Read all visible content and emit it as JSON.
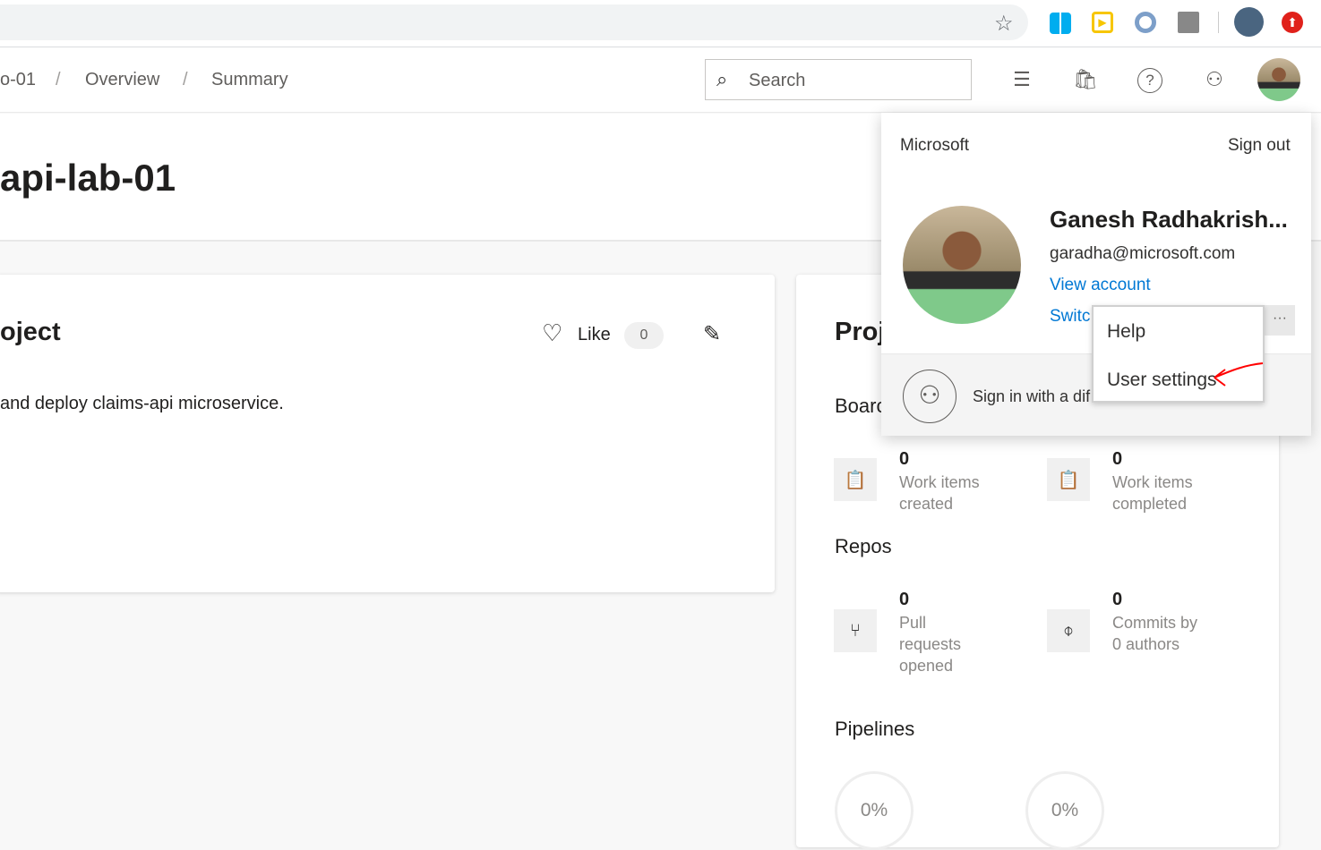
{
  "browser": {
    "icons": [
      "star-icon",
      "windows-icon",
      "play-icon",
      "cortana-icon",
      "office-icon",
      "profile-avatar",
      "update-icon"
    ]
  },
  "breadcrumb": [
    "o-01",
    "/",
    "Overview",
    "/",
    "Summary"
  ],
  "search": {
    "placeholder": "Search"
  },
  "header_icons": [
    "task-list-icon",
    "shopping-bag-icon",
    "help-icon",
    "user-settings-icon",
    "avatar"
  ],
  "page_title": "api-lab-01",
  "about": {
    "title": "oject",
    "like_label": "Like",
    "like_count": "0",
    "description": "and deploy claims-api microservice."
  },
  "stats": {
    "title": "Proj",
    "boards": "Boarc",
    "boards_items": [
      {
        "value": "0",
        "label": "Work items created"
      },
      {
        "value": "0",
        "label": "Work items completed"
      }
    ],
    "repos": "Repos",
    "repos_items": [
      {
        "value": "0",
        "label": "Pull requests opened"
      },
      {
        "value": "0",
        "label": "Commits by 0 authors"
      }
    ],
    "pipelines": "Pipelines",
    "pipelines_items": [
      "0%",
      "0%"
    ]
  },
  "account": {
    "org": "Microsoft",
    "sign_out": "Sign out",
    "name": "Ganesh Radhakrish...",
    "email": "garadha@microsoft.com",
    "view_account": "View account",
    "switch": "Switc",
    "more": "···",
    "sign_in_other": "Sign in with a dif"
  },
  "menu": {
    "items": [
      "Help",
      "User settings"
    ]
  },
  "colors": {
    "link": "#0078d4",
    "annotation": "#ff0000"
  }
}
